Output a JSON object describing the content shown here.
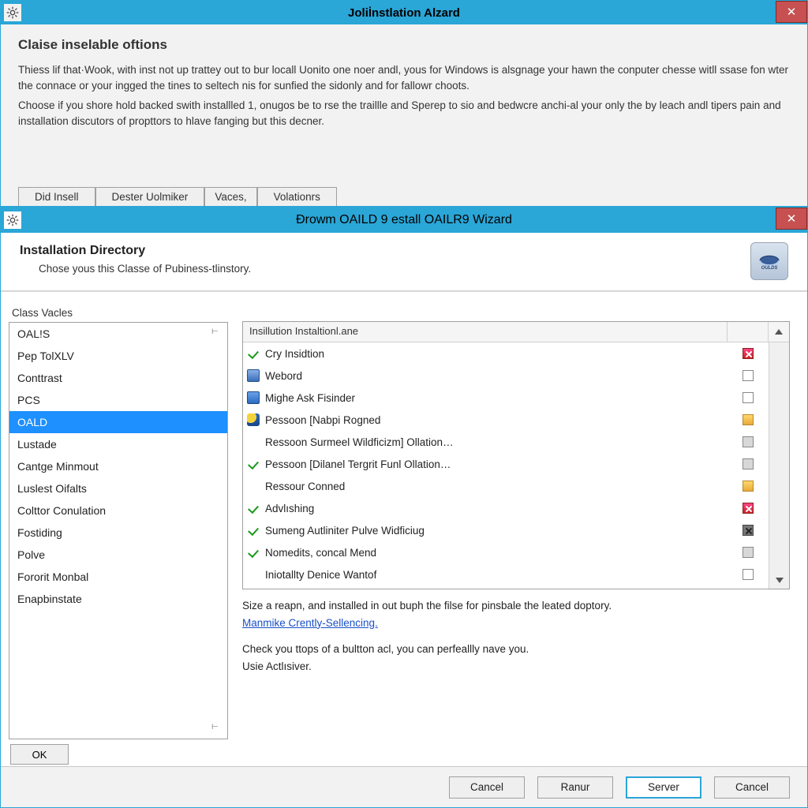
{
  "window1": {
    "title": "Joliİnstlation Alzard",
    "heading": "Claise inselable oftions",
    "para1": "Thiess lif that·Wook, with inst not up trattey out to bur locall Uonito one noer andl, yous for Windows is alsgnage your hawn the conputer chesse witll ssase fon wter the connace or your ingged the tines to seltech nis for sunfied the sidonly and for fallowr choots.",
    "para2": "Choose if you shore hold backed swith installled 1, onugos be to rse the traillle and Sperep to sio and bedwcre anchi-al your only the by leach andl tipers pain and installation discutors of propttors to hlave fanging but this decner.",
    "tabs": [
      "Did Insell",
      "Dester  Uolmiker",
      "Vaces,",
      "Volationrs"
    ]
  },
  "window2": {
    "title": "Đrowm OAILD 9 estall OAILR9 Wizard",
    "heading": "Installation Directory",
    "subheading": "Chose yous this Classe of Pubiness-tlinstory.",
    "logo_text": "OULDS",
    "sidebar": {
      "label": "Class Vacles",
      "items": [
        "OAL!S",
        "Pep TolXLV",
        "Conttrast",
        "PCS",
        "OALD",
        "Lustade",
        "Cantge Minmout",
        "Luslest Oifalts",
        "Colttor Conulation",
        "Fostiding",
        "Polve",
        "Fororit Monbal",
        "Enapbinstate"
      ],
      "selected_index": 4,
      "ok_label": "OK"
    },
    "grid": {
      "header_col1": "Insillution Instaltionl.ane",
      "rows": [
        {
          "icon": "check",
          "label": "Cry Insidtion",
          "status": "redx"
        },
        {
          "icon": "box",
          "label": "Webord",
          "status": "blank"
        },
        {
          "icon": "folder",
          "label": "Mighe Ask Fisinder",
          "status": "blank"
        },
        {
          "icon": "shield",
          "label": "Pessoon [Nabpi Rogned",
          "status": "amber"
        },
        {
          "icon": "none",
          "label": "Ressoon Surmeel Wildficizm] Ollation…",
          "status": "gray"
        },
        {
          "icon": "check",
          "label": "Pessoon [Dilanel Tergrit Funl Ollation…",
          "status": "gray"
        },
        {
          "icon": "none",
          "label": "Ressour Conned",
          "status": "amber"
        },
        {
          "icon": "check",
          "label": "Advlıshing",
          "status": "redx"
        },
        {
          "icon": "check",
          "label": "Sumeng Autliniter Pulve Widficiug",
          "status": "darkx"
        },
        {
          "icon": "check",
          "label": "Nomedits, concal Mend",
          "status": "gray"
        },
        {
          "icon": "none",
          "label": "Iniotallty Denice Wantof",
          "status": "blank"
        }
      ]
    },
    "below": {
      "line1": "Size a reapn, and installed in out buph the filse for pinsbale the leated doptory.",
      "link": "Manmike Crently-Sellencing.",
      "line2": "Check you ttops of a bultton acl, you can perfeallly nave you.",
      "line3": "Usie Actlısiver."
    },
    "buttons": {
      "cancel1": "Cancel",
      "ranur": "Ranur",
      "server": "Server",
      "cancel2": "Cancel"
    }
  }
}
